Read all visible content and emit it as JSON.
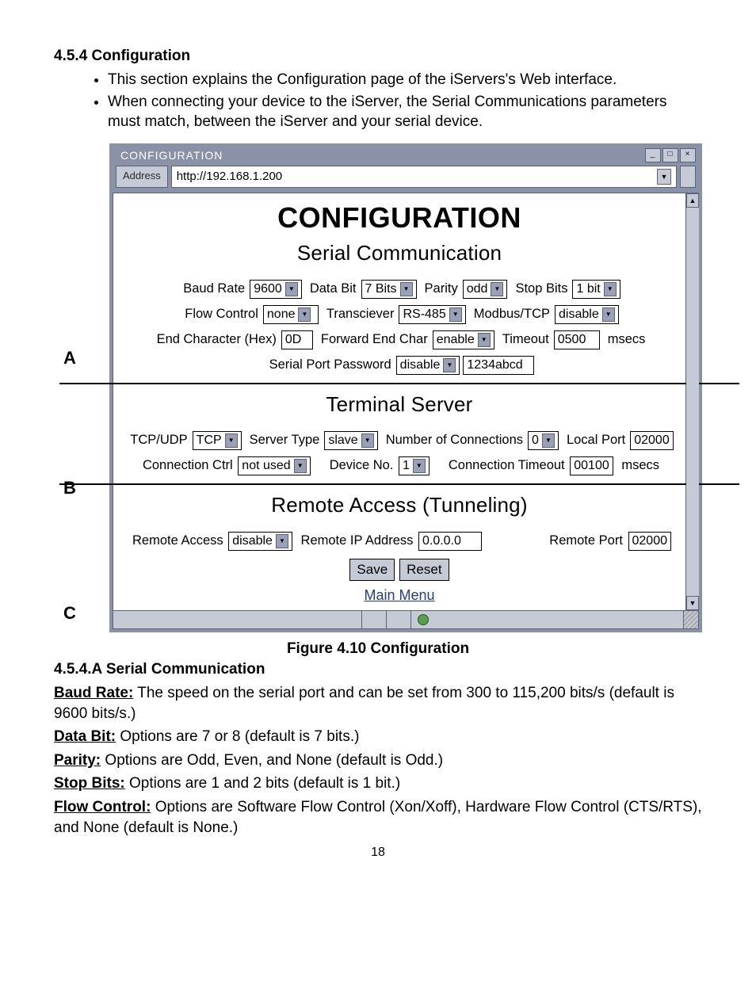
{
  "section_number": "4.5.4 Configuration",
  "intro": {
    "b1": "This section explains the Configuration page of the iServers's Web interface.",
    "b2": "When connecting your device to the iServer, the Serial Communications parameters must match, between the iServer and your serial device."
  },
  "letters": {
    "A": "A",
    "B": "B",
    "C": "C"
  },
  "window": {
    "title": "CONFIGURATION",
    "min": "_",
    "max": "□",
    "close": "×",
    "address_label": "Address",
    "url": "http://192.168.1.200"
  },
  "page_title": "CONFIGURATION",
  "serial": {
    "heading": "Serial Communication",
    "baud_rate_label": "Baud Rate",
    "baud_rate": "9600",
    "data_bit_label": "Data Bit",
    "data_bit": "7 Bits",
    "parity_label": "Parity",
    "parity": "odd",
    "stop_bits_label": "Stop Bits",
    "stop_bits": "1 bit",
    "flow_label": "Flow Control",
    "flow": "none",
    "trans_label": "Transciever",
    "trans": "RS-485",
    "modbus_label": "Modbus/TCP",
    "modbus": "disable",
    "endchar_label": "End Character (Hex)",
    "endchar": "0D",
    "fwdend_label": "Forward End Char",
    "fwdend": "enable",
    "timeout_label": "Timeout",
    "timeout": "0500",
    "timeout_unit": "msecs",
    "sp_pwd_label": "Serial Port Password",
    "sp_pwd_state": "disable",
    "sp_pwd": "1234abcd"
  },
  "terminal": {
    "heading": "Terminal Server",
    "tcpudp_label": "TCP/UDP",
    "tcpudp": "TCP",
    "srvtype_label": "Server Type",
    "srvtype": "slave",
    "numconn_label": "Number of Connections",
    "numconn": "0",
    "localport_label": "Local Port",
    "localport": "02000",
    "connctrl_label": "Connection Ctrl",
    "connctrl": "not used",
    "devno_label": "Device No.",
    "devno": "1",
    "conntimeout_label": "Connection Timeout",
    "conntimeout": "00100",
    "conntimeout_unit": "msecs"
  },
  "remote": {
    "heading": "Remote Access (Tunneling)",
    "ra_label": "Remote Access",
    "ra": "disable",
    "rip_label": "Remote IP Address",
    "rip": "0.0.0.0",
    "rport_label": "Remote Port",
    "rport": "02000"
  },
  "actions": {
    "save": "Save",
    "reset": "Reset",
    "main_menu": "Main Menu"
  },
  "figure_caption": "Figure 4.10  Configuration",
  "body_heading": "4.5.4.A  Serial Communication",
  "defs": {
    "baud_term": "Baud Rate:",
    "baud_text": "  The speed on the serial port and can be set from 300 to 115,200 bits/s (default is 9600 bits/s.)",
    "databit_term": "Data Bit:",
    "databit_text": "  Options are 7 or 8 (default is 7 bits.)",
    "parity_term": "Parity:",
    "parity_text": "  Options are Odd, Even, and None (default is Odd.)",
    "stop_term": "Stop Bits:",
    "stop_text": "  Options are 1 and 2 bits (default is 1 bit.)",
    "flow_term": "Flow Control:",
    "flow_text": "  Options are Software Flow Control (Xon/Xoff), Hardware Flow Control (CTS/RTS), and None (default is None.)"
  },
  "page_number": "18"
}
